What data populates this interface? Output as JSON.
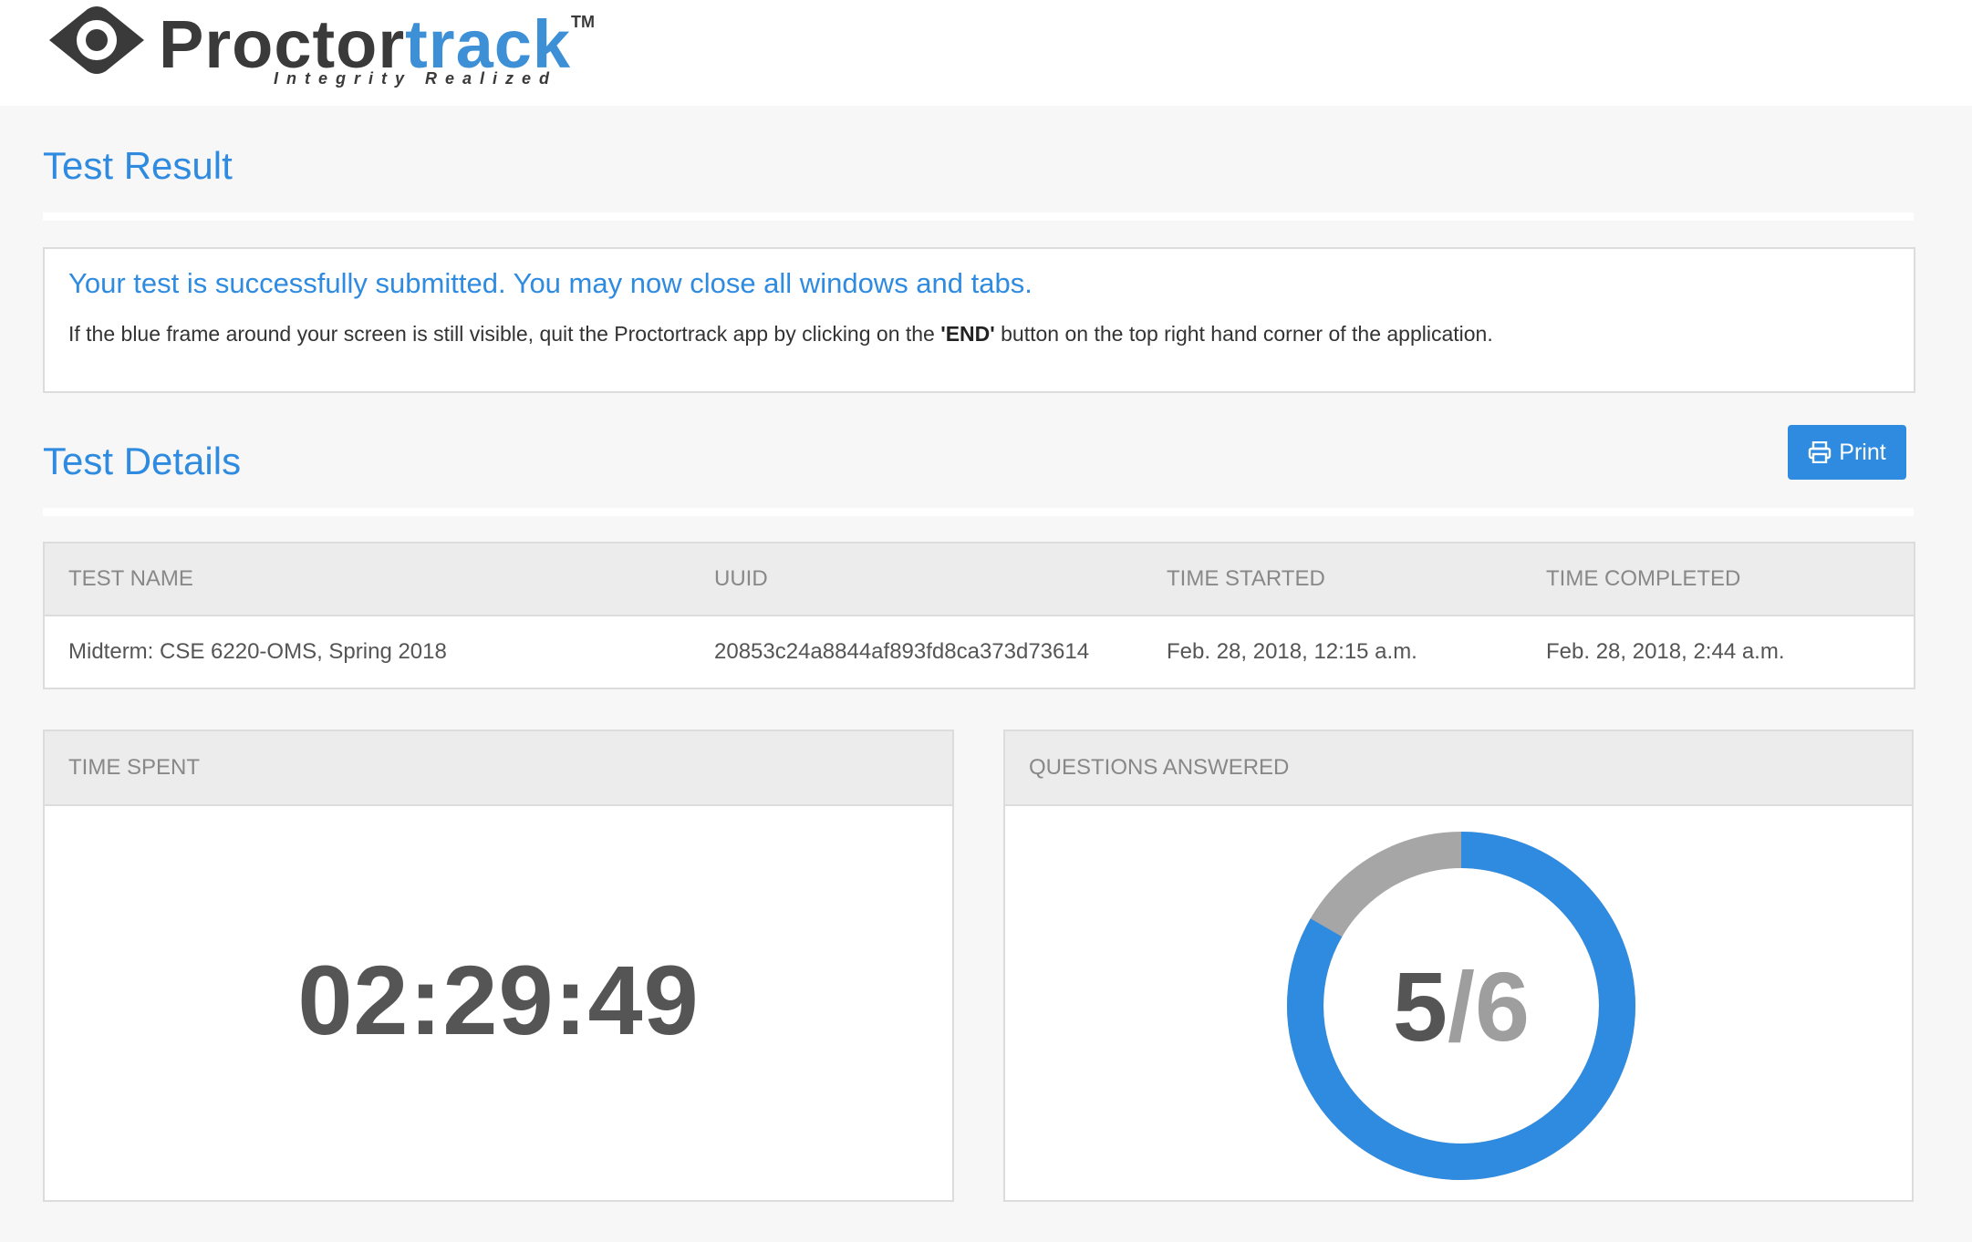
{
  "brand": {
    "name_dark": "Proctor",
    "name_blue": "track",
    "trademark": "TM",
    "tagline": "Integrity Realized",
    "colors": {
      "blue": "#3d8fd6",
      "dark": "#3a3a3a"
    }
  },
  "result": {
    "title": "Test Result",
    "notice_title": "Your test is successfully submitted. You may now close all windows and tabs.",
    "notice_text_before": "If the blue frame around your screen is still visible, quit the Proctortrack app by clicking on the ",
    "notice_text_bold": "'END'",
    "notice_text_after": " button on the top right hand corner of the application."
  },
  "details": {
    "title": "Test Details",
    "print_label": "Print",
    "print_icon": "printer-icon",
    "columns": [
      "TEST NAME",
      "UUID",
      "TIME STARTED",
      "TIME COMPLETED"
    ],
    "rows": [
      [
        "Midterm: CSE 6220-OMS, Spring 2018",
        "20853c24a8844af893fd8ca373d73614",
        "Feb. 28, 2018, 12:15 a.m.",
        "Feb. 28, 2018, 2:44 a.m."
      ]
    ]
  },
  "time_spent": {
    "label": "TIME SPENT",
    "value": "02:29:49"
  },
  "questions": {
    "label": "QUESTIONS ANSWERED",
    "answered": "5",
    "separator": "/",
    "total": "6",
    "answered_fraction": 0.8333,
    "colors": {
      "answered": "#2f8be0",
      "remaining": "#a6a6a6"
    }
  },
  "accent_color": "#2f8be0"
}
